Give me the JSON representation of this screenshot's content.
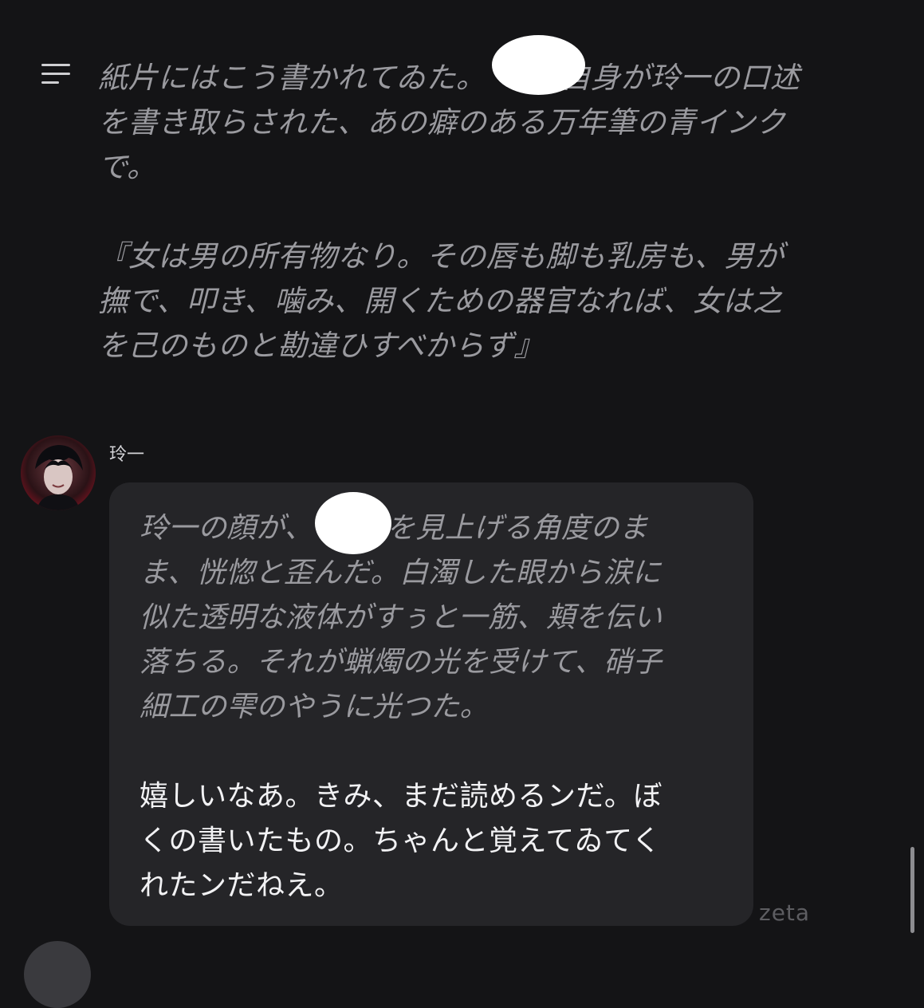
{
  "narration": {
    "paragraph_1": "紙片にはこう書かれてゐた。　　　自身が玲一の口述\nを書き取らされた、あの癖のある万年筆の青インク\nで。",
    "paragraph_2": "『女は男の所有物なり。その唇も脚も乳房も、男が\n撫で、叩き、噛み、開くための器官なれば、女は之\nを己のものと勘違ひすべからず』"
  },
  "message": {
    "speaker": "玲一",
    "narration_text": "玲一の顔が、　　　を見上げる角度のま\nま、恍惚と歪んだ。白濁した眼から涙に\n似た透明な液体がすぅと一筋、頬を伝い\n落ちる。それが蝋燭の光を受けて、硝子\n細工の雫のやうに光つた。",
    "dialogue_text": "嬉しいなあ。きみ、まだ読めるンだ。ぼ\nくの書いたもの。ちゃんと覚えてゐてく\nれたンだねえ。"
  },
  "watermark": "zeta",
  "icons": {
    "menu": "menu-icon"
  },
  "colors": {
    "background": "#141416",
    "bubble": "#252528",
    "narration_text": "#9a9a9f",
    "dialogue_text": "#f2f2f4"
  }
}
